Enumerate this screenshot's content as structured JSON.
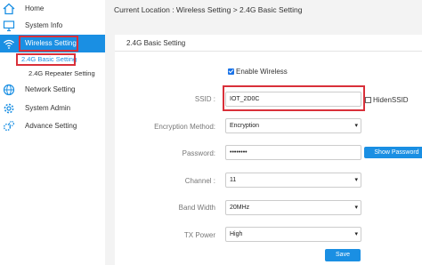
{
  "sidebar": {
    "items": [
      {
        "label": "Home",
        "icon": "home-icon"
      },
      {
        "label": "System Info",
        "icon": "monitor-icon"
      },
      {
        "label": "Wireless Setting",
        "icon": "wifi-icon"
      },
      {
        "label": "Network Setting",
        "icon": "globe-icon"
      },
      {
        "label": "System Admin",
        "icon": "gear-icon"
      },
      {
        "label": "Advance Setting",
        "icon": "gears-icon"
      }
    ],
    "subitems": [
      "2.4G Basic Setting",
      "2.4G Repeater Setting"
    ]
  },
  "breadcrumb": "Current Location : Wireless Setting > 2.4G Basic Setting",
  "panel": {
    "title": "2.4G Basic Setting",
    "enable_label": "Enable Wireless",
    "ssid_label": "SSID :",
    "ssid_value": "IOT_2D0C",
    "hide_label": "HidenSSID",
    "enc_label": "Encryption Method:",
    "enc_value": "Encryption",
    "pwd_label": "Password:",
    "pwd_value": "••••••••",
    "show_pwd_label": "Show Password",
    "channel_label": "Channel :",
    "channel_value": "11",
    "bw_label": "Band Width",
    "bw_value": "20MHz",
    "tx_label": "TX Power",
    "tx_value": "High",
    "save_label": "Save"
  },
  "colors": {
    "accent": "#1a8fe3",
    "highlight": "#d9303a"
  }
}
